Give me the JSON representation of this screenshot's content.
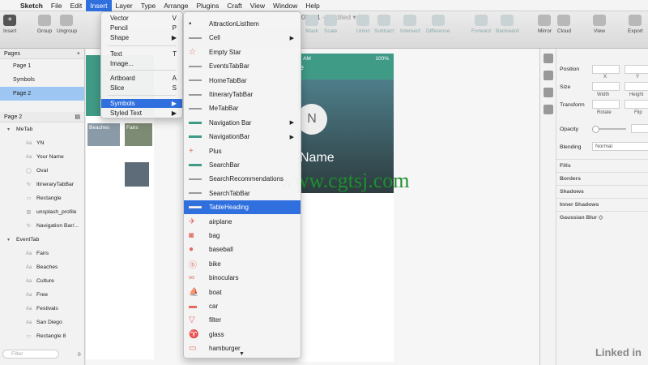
{
  "menubar": {
    "apple": "",
    "items": [
      "Sketch",
      "File",
      "Edit",
      "Insert",
      "Layer",
      "Type",
      "Arrange",
      "Plugins",
      "Craft",
      "View",
      "Window",
      "Help"
    ],
    "active": "Insert"
  },
  "document": {
    "name": "03_01",
    "status": "— Edited ▾"
  },
  "toolbar": {
    "insert": "Insert",
    "group": "Group",
    "ungroup": "Ungroup",
    "mask": "Mask",
    "scale": "Scale",
    "union": "Union",
    "subtract": "Subtract",
    "intersect": "Intersect",
    "difference": "Difference",
    "forward": "Forward",
    "backward": "Backward",
    "mirror": "Mirror",
    "cloud": "Cloud",
    "view": "View",
    "export": "Export"
  },
  "sidebar": {
    "pages_header": "Pages",
    "pages": [
      "Page 1",
      "Symbols",
      "Page 2"
    ],
    "selected_page": "Page 2",
    "current_page_header": "Page 2",
    "layers": [
      {
        "label": "MeTab",
        "kind": "group",
        "icon": "▾"
      },
      {
        "label": "YN",
        "kind": "text",
        "icon": "Aa"
      },
      {
        "label": "Your Name",
        "kind": "text",
        "icon": "Aa"
      },
      {
        "label": "Oval",
        "kind": "shape",
        "icon": "◯"
      },
      {
        "label": "ItineraryTabBar",
        "kind": "symbol",
        "icon": "↻"
      },
      {
        "label": "Rectangle",
        "kind": "shape",
        "icon": "▭"
      },
      {
        "label": "unsplash_profile",
        "kind": "image",
        "icon": "▨"
      },
      {
        "label": "Navigation Bar/...",
        "kind": "symbol",
        "icon": "↻"
      },
      {
        "label": "EventTab",
        "kind": "group",
        "icon": "▾"
      },
      {
        "label": "Fairs",
        "kind": "text",
        "icon": "Aa"
      },
      {
        "label": "Beaches",
        "kind": "text",
        "icon": "Aa"
      },
      {
        "label": "Culture",
        "kind": "text",
        "icon": "Aa"
      },
      {
        "label": "Free",
        "kind": "text",
        "icon": "Aa"
      },
      {
        "label": "Festivals",
        "kind": "text",
        "icon": "Aa"
      },
      {
        "label": "San Diego",
        "kind": "text",
        "icon": "Aa"
      },
      {
        "label": "Rectangle 8",
        "kind": "shape",
        "icon": "▭"
      }
    ],
    "filter_placeholder": "Filter",
    "filter_count": "0"
  },
  "canvas": {
    "thumb_beaches": "Beaches",
    "thumb_fairs": "Fairs",
    "artboard": {
      "time": "AM",
      "battery": "100%",
      "initials": "N",
      "name": "Name",
      "letter": "e"
    },
    "watermark": "www.cgtsj.com",
    "brand": "Linked in"
  },
  "inspector": {
    "position": "Position",
    "x": "X",
    "y": "Y",
    "size": "Size",
    "width": "Width",
    "height": "Height",
    "transform": "Transform",
    "rotate": "Rotate",
    "flip": "Flip",
    "opacity": "Opacity",
    "blending": "Blending",
    "blending_value": "Normal",
    "sections": [
      "Fills",
      "Borders",
      "Shadows",
      "Inner Shadows",
      "Gaussian Blur ◇"
    ]
  },
  "insert_menu": {
    "items": [
      {
        "label": "Vector",
        "shortcut": "V"
      },
      {
        "label": "Pencil",
        "shortcut": "P"
      },
      {
        "label": "Shape",
        "shortcut": "▶"
      },
      {
        "label": "Text",
        "shortcut": "T"
      },
      {
        "label": "Image...",
        "shortcut": ""
      },
      {
        "label": "Artboard",
        "shortcut": "A"
      },
      {
        "label": "Slice",
        "shortcut": "S"
      },
      {
        "label": "Symbols",
        "shortcut": "▶"
      },
      {
        "label": "Styled Text",
        "shortcut": "▶"
      }
    ],
    "selected": "Symbols"
  },
  "symbols_menu": {
    "items": [
      {
        "label": "AttractionListItem",
        "icon": "list-item-icon",
        "submenu": false
      },
      {
        "label": "Cell",
        "icon": "line-icon",
        "submenu": true
      },
      {
        "label": "Empty Star",
        "icon": "star-icon",
        "submenu": false
      },
      {
        "label": "EventsTabBar",
        "icon": "line-icon",
        "submenu": false
      },
      {
        "label": "HomeTabBar",
        "icon": "line-icon",
        "submenu": false
      },
      {
        "label": "ItineraryTabBar",
        "icon": "line-icon",
        "submenu": false
      },
      {
        "label": "MeTabBar",
        "icon": "line-icon",
        "submenu": false
      },
      {
        "label": "Navigation Bar",
        "icon": "teal-bar-icon",
        "submenu": true
      },
      {
        "label": "NavigationBar",
        "icon": "teal-bar-icon",
        "submenu": true
      },
      {
        "label": "Plus",
        "icon": "plus-icon",
        "submenu": false
      },
      {
        "label": "SearchBar",
        "icon": "teal-bar-icon",
        "submenu": false
      },
      {
        "label": "SearchRecommendations",
        "icon": "line-icon",
        "submenu": false
      },
      {
        "label": "SearchTabBar",
        "icon": "line-icon",
        "submenu": false
      },
      {
        "label": "TableHeading",
        "icon": "white-bar-icon",
        "submenu": false
      },
      {
        "label": "airplane",
        "icon": "airplane-icon",
        "submenu": false
      },
      {
        "label": "bag",
        "icon": "bag-icon",
        "submenu": false
      },
      {
        "label": "baseball",
        "icon": "baseball-icon",
        "submenu": false
      },
      {
        "label": "bike",
        "icon": "bike-icon",
        "submenu": false
      },
      {
        "label": "binoculars",
        "icon": "binoculars-icon",
        "submenu": false
      },
      {
        "label": "boat",
        "icon": "boat-icon",
        "submenu": false
      },
      {
        "label": "car",
        "icon": "car-icon",
        "submenu": false
      },
      {
        "label": "filter",
        "icon": "filter-icon",
        "submenu": false
      },
      {
        "label": "glass",
        "icon": "glass-icon",
        "submenu": false
      },
      {
        "label": "hamburger",
        "icon": "hamburger-icon",
        "submenu": false
      }
    ],
    "selected": "TableHeading",
    "icon_color": "#e26a5f",
    "accent": "#2f6fde"
  }
}
